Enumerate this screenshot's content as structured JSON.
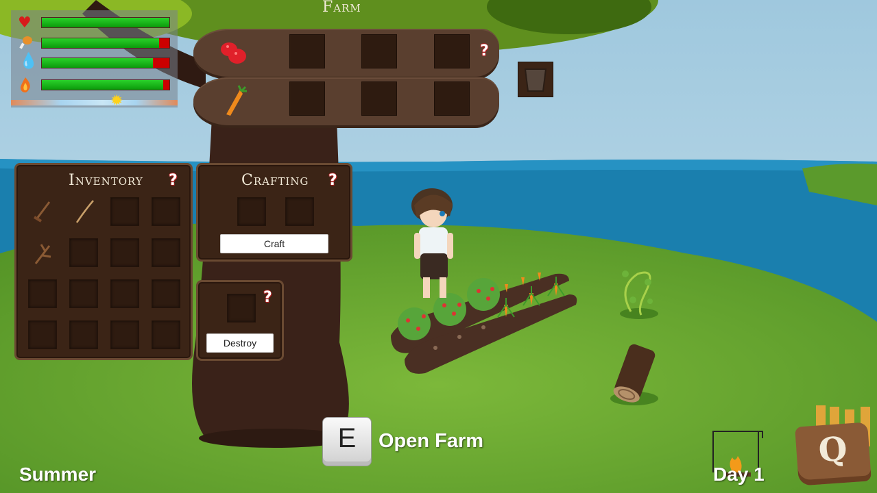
{
  "farm": {
    "title": "Farm",
    "help": "?",
    "rows": [
      {
        "seed_icon": "raspberry-icon"
      },
      {
        "seed_icon": "carrot-icon"
      }
    ]
  },
  "stats": {
    "health": {
      "icon": "heart-icon",
      "level": 1.0
    },
    "hunger": {
      "icon": "drumstick-icon",
      "level": 0.92
    },
    "thirst": {
      "icon": "water-drop-icon",
      "level": 0.87
    },
    "warmth": {
      "icon": "fire-icon",
      "level": 0.95
    },
    "day_progress_icon": "sun-icon"
  },
  "inventory": {
    "title": "Inventory",
    "help": "?",
    "items": [
      "hoe-icon",
      "fishing-rod-icon",
      "stick-icon"
    ]
  },
  "crafting": {
    "title": "Crafting",
    "help": "?",
    "craft_label": "Craft"
  },
  "destroy": {
    "help": "?",
    "destroy_label": "Destroy"
  },
  "prompt": {
    "key": "E",
    "action": "Open Farm"
  },
  "hud": {
    "season": "Summer",
    "day": "Day 1",
    "quest_key": "Q"
  },
  "colors": {
    "sky": "#a8cfe2",
    "sea": "#1a7fae",
    "grass": "#6aa632",
    "panel": "#3b2416",
    "bar_green": "#19b519",
    "bar_red": "#cc0000"
  }
}
